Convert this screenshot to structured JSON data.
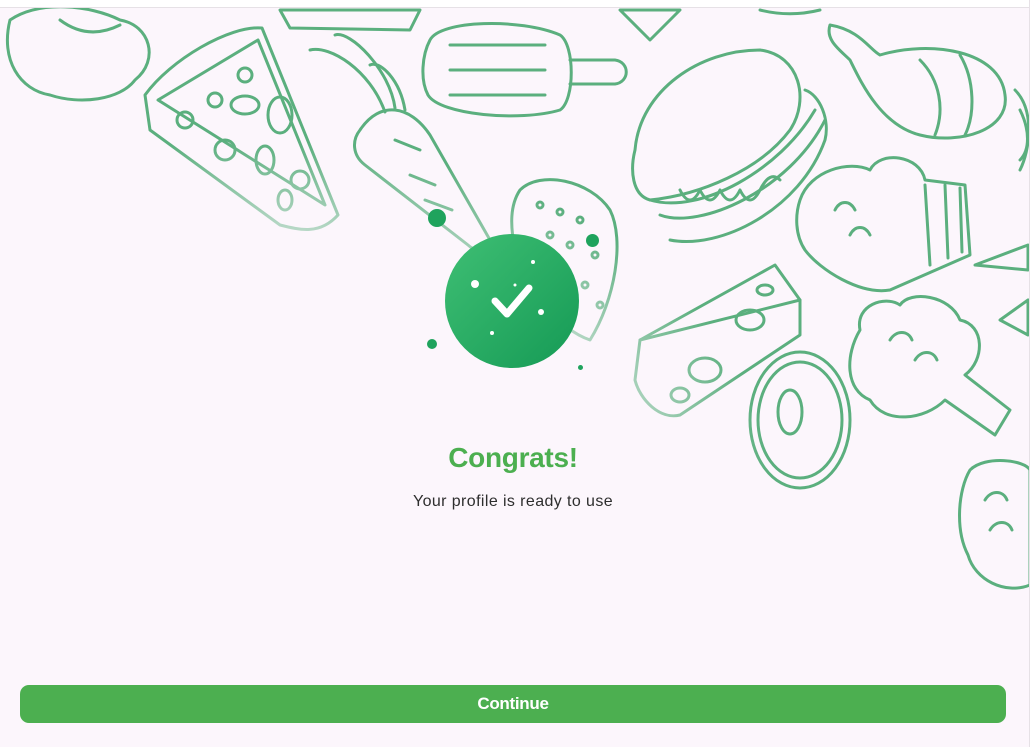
{
  "colors": {
    "background": "#fcf6fc",
    "accent": "#4caf50",
    "doodle_stroke": "#4aa871",
    "badge_gradient_start": "#3fbf74",
    "badge_gradient_end": "#159a55"
  },
  "background": {
    "illustration": "food-doodle-pattern",
    "items": [
      "pepper-icon",
      "pizza-slice-icon",
      "carrot-icon",
      "popsicle-icon",
      "strawberry-icon",
      "burger-icon",
      "garlic-icon",
      "cupcake-icon",
      "cheese-icon",
      "donut-icon",
      "broccoli-icon"
    ]
  },
  "success": {
    "icon": "check-icon",
    "title": "Congrats!",
    "message": "Your profile is ready to use"
  },
  "actions": {
    "continue_label": "Continue"
  }
}
